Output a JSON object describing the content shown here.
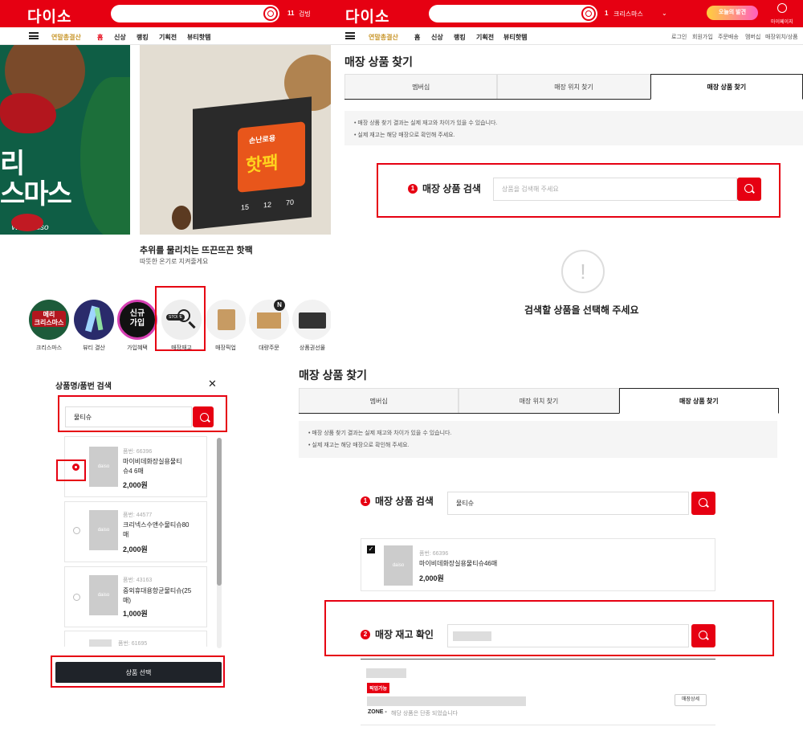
{
  "tl": {
    "logo": "다이소",
    "cart_count": "11",
    "cart_label": "검빙",
    "nav": [
      "연말총결산",
      "홈",
      "신상",
      "랭킹",
      "기획전",
      "뷰티핫템"
    ],
    "caption_title": "추위를 물리치는 뜨끈뜨끈 핫팩",
    "caption_sub": "따뜻한 온기로 지켜줄게요",
    "art_left": [
      "리",
      "스마스"
    ],
    "art_script": "With daiso",
    "art_box": "핫팩",
    "art_box2": "손난로용",
    "art_box_nums": [
      "15",
      "12",
      "70"
    ],
    "art_box_text": "핫팩",
    "circles": [
      {
        "label": "크리스마스",
        "inner": "메리\n크리스마스"
      },
      {
        "label": "뷰티 결산",
        "inner": ""
      },
      {
        "label": "가입혜택",
        "inner": "신규\n가입"
      },
      {
        "label": "매장재고",
        "inner": "STORE"
      },
      {
        "label": "매장픽업",
        "inner": ""
      },
      {
        "label": "대량주문",
        "inner": ""
      },
      {
        "label": "상품권선물",
        "inner": ""
      }
    ],
    "badge_n": "N"
  },
  "bl": {
    "title": "상품명/품번 검색",
    "close": "✕",
    "query": "물티슈",
    "items": [
      {
        "code": "품번: 66396",
        "name": "마이비데화장실용물티슈4 6매",
        "price": "2,000원"
      },
      {
        "code": "품번: 44577",
        "name": "크리넥스수앤수물티슈80 매",
        "price": "2,000원"
      },
      {
        "code": "품번: 43163",
        "name": "중외휴대용항균물티슈(25 매)",
        "price": "1,000원"
      },
      {
        "code": "품번: 61695",
        "name": "",
        "price": ""
      }
    ],
    "thumb_text": "daiso",
    "select_btn": "상품 선택"
  },
  "tr": {
    "logo": "다이소",
    "cart_count": "1",
    "cart_label": "크리스마스",
    "promo": "오늘의 발견",
    "mypage": "마이페이지",
    "nav": [
      "연말총결산",
      "홈",
      "신상",
      "랭킹",
      "기획전",
      "뷰티핫템"
    ],
    "util": [
      "로그인",
      "회원가입",
      "주문배송",
      "멤버십",
      "매장위치/상품"
    ],
    "page_title": "매장 상품 찾기",
    "tabs": [
      "멤버십",
      "매장 위치 찾기",
      "매장 상품 찾기"
    ],
    "notices": [
      "• 매장 상품 찾기 결과는 실제 재고와 차이가 있을 수 있습니다.",
      "• 실제 재고는 해당 매장으로 확인해 주세요."
    ],
    "step1_num": "1",
    "step1": "매장 상품 검색",
    "placeholder": "상품을 검색해 주세요",
    "empty_icon": "!",
    "empty_msg": "검색할 상품을 선택해 주세요"
  },
  "br": {
    "page_title": "매장 상품 찾기",
    "tabs": [
      "멤버십",
      "매장 위치 찾기",
      "매장 상품 찾기"
    ],
    "notices": [
      "• 매장 상품 찾기 결과는 실제 재고와 차이가 있을 수 있습니다.",
      "• 실제 재고는 해당 매장으로 확인해 주세요."
    ],
    "step1_num": "1",
    "step1": "매장 상품 검색",
    "query": "물티슈",
    "result": {
      "code": "품번: 66396",
      "name": "마이비데화장실용물티슈46매",
      "price": "2,000원"
    },
    "thumb_text": "daiso",
    "step2_num": "2",
    "step2": "매장 재고 확인",
    "pickup_badge": "픽업가능",
    "store_detail": "매장상세",
    "zone_label": "ZONE -",
    "zone_note": "해당 상품은 단종 되었습니다"
  },
  "colors": {
    "brand": "#e60012",
    "dark": "#1f2329"
  }
}
